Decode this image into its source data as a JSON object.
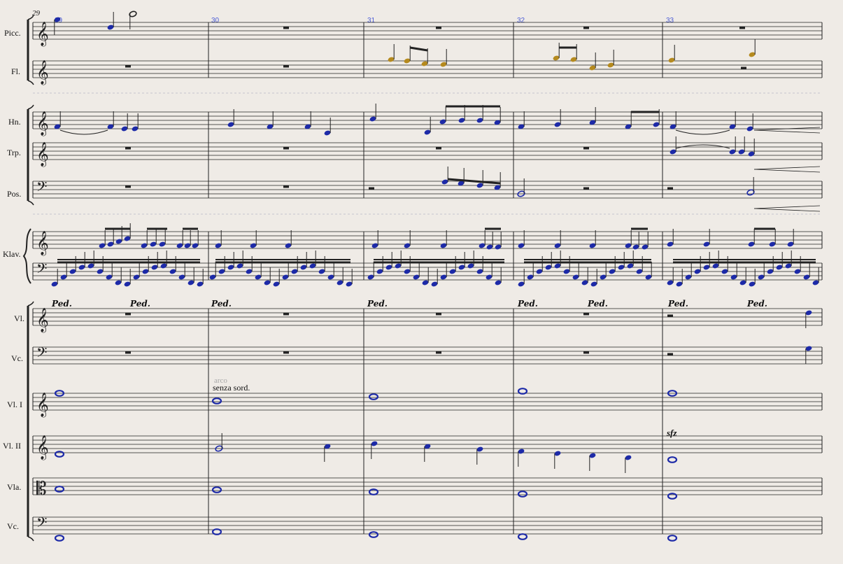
{
  "score": {
    "first_measure_number": "29",
    "measure_numbers": [
      "29",
      "30",
      "31",
      "32",
      "33"
    ],
    "instruments": [
      {
        "label": "Picc.",
        "clef": "treble"
      },
      {
        "label": "Fl.",
        "clef": "treble"
      },
      {
        "label": "Hn.",
        "clef": "treble"
      },
      {
        "label": "Trp.",
        "clef": "treble"
      },
      {
        "label": "Pos.",
        "clef": "bass"
      },
      {
        "label": "Klav.",
        "clef": "grand"
      },
      {
        "label": "Vl.",
        "clef": "treble"
      },
      {
        "label": "Vc.",
        "clef": "bass"
      },
      {
        "label": "Vl. I",
        "clef": "treble"
      },
      {
        "label": "Vl. II",
        "clef": "treble"
      },
      {
        "label": "Vla.",
        "clef": "alto"
      },
      {
        "label": "Vc.",
        "clef": "bass"
      }
    ],
    "text_marks": {
      "arco": "arco",
      "senza_sord": "senza sord.",
      "sfz": "sfz",
      "pedal": "Ped."
    },
    "colors": {
      "note_blue": "#1d2aa8",
      "note_gold": "#b58a1e",
      "staff_line": "#222222",
      "measure_number": "#4a5bd6",
      "background": "#efebe6"
    }
  }
}
